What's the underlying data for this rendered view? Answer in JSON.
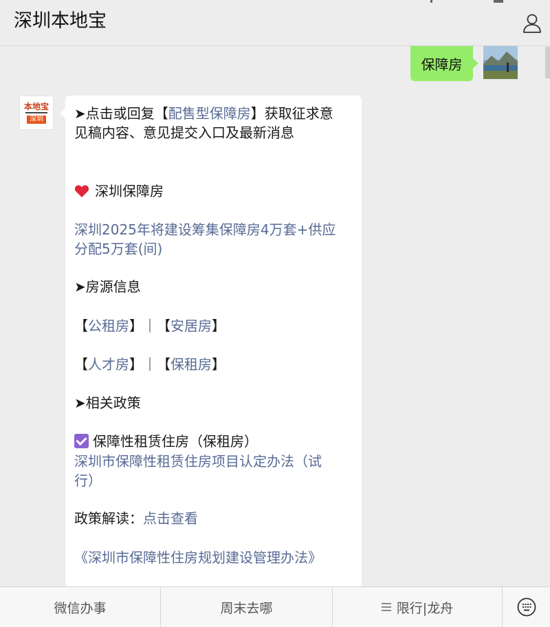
{
  "header": {
    "title": "深圳本地宝"
  },
  "sent": {
    "text": "保障房"
  },
  "bot": {
    "logo_text_top": "本地宝",
    "logo_text_bottom": "深圳"
  },
  "message": {
    "l1_pre": "➤点击或回复【",
    "l1_link": "配售型保障房",
    "l1_post": "】获取征求意",
    "l2": "见稿内容、意见提交入口及最新消息",
    "section_housing": "深圳保障房",
    "news_l1": "深圳2025年将建设筹集保障房4万套+供应",
    "news_l2": "分配5万套(间)",
    "source_heading": "➤房源信息",
    "bracket_open": "【",
    "bracket_close": "】",
    "separator": "｜",
    "public_rent": "公租房",
    "anju": "安居房",
    "talent": "人才房",
    "guarantee_rent": "保租房",
    "policy_heading": "➤相关政策",
    "rent_title": "保障性租赁住房（保租房）",
    "rent_link_l1": "深圳市保障性租赁住房项目认定办法（试",
    "rent_link_l2": "行）",
    "interpret_label": "政策解读：",
    "interpret_link": "点击查看",
    "plan_link": "《深圳市保障性住房规划建设管理办法》"
  },
  "menu": {
    "item1": "微信办事",
    "item2": "周末去哪",
    "item3": "限行|龙舟"
  },
  "icons": [
    "profile-icon",
    "heart-icon",
    "check-icon",
    "hamburger-icon",
    "keyboard-icon"
  ],
  "colors": {
    "link": "#576b95",
    "sent_bubble": "#95ec69",
    "background": "#ededed"
  }
}
